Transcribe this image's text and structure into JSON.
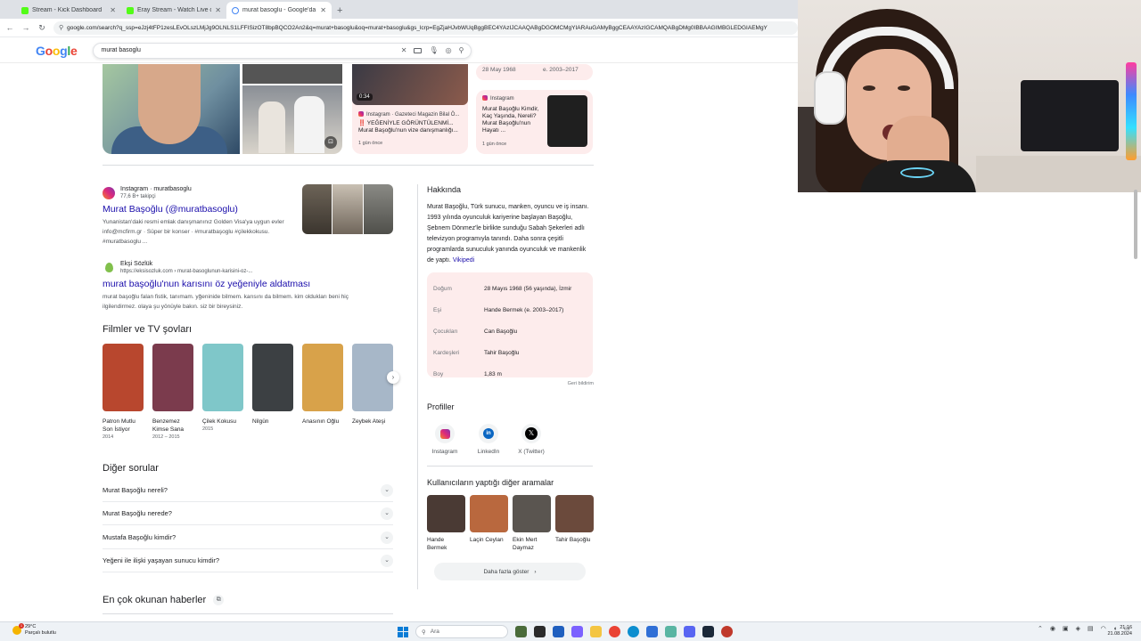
{
  "browser": {
    "tabs": [
      {
        "label": "Stream - Kick Dashboard",
        "favicon": "kick-icon"
      },
      {
        "label": "Eray Stream - Watch Live on Ki",
        "favicon": "kick-icon"
      },
      {
        "label": "murat basoglu - Google'da Ara",
        "favicon": "google-icon",
        "active": true
      }
    ],
    "url": "google.com/search?q_ssp=eJzj4tFP1zesLEvOLszLMjJg9OLNLS1LFFISizOT8bpBQCO2An2&q=murat+basoglu&oq=murat+basoglu&gs_lcrp=EgZjaHJvbWUqBggBEC4YAzIJCAAQABgDGOMCMgYIARAuGAMyBggCEAAYAzIGCAMQABgDMg0IBBAAGIMBGLEDGIAEMgY"
  },
  "search": {
    "logo": "Google",
    "query": "murat basoglu"
  },
  "top_cards": {
    "video_duration": "0:34",
    "card1_source": "Instagram · Gazeteci Magazin Bilal Ö...",
    "card1_title": "‼️ YEĞENİYLE GÖRÜNTÜLENMİ... Murat Başoğlu'nun vize danışmanlığı...",
    "card1_ago": "1 gün önce",
    "card2_date": "28 May 1968",
    "card2_years": "e. 2003–2017",
    "card3_source": "Instagram",
    "card3_title": "Murat Başoğlu Kimdir, Kaç Yaşında, Nereli? Murat Başoğlu'nun Hayatı ...",
    "card3_ago": "1 gün önce"
  },
  "results": [
    {
      "site": "Instagram · muratbasoglu",
      "sub": "77,6 B+ takipçi",
      "title": "Murat Başoğlu (@muratbasoglu)",
      "snippet": "Yunanistan'daki resmi emlak danışmanınız Golden Visa'ya uygun evler info@mcfirm.gr · Süper bir konser · #muratbaşoglu #çilekkokusu. #muratbasoglu ..."
    },
    {
      "site": "Ekşi Sözlük",
      "sub": "https://eksisozluk.com › murat-basoglunun-karisini-oz-...",
      "title": "murat başoğlu'nun karısını öz yeğeniyle aldatması",
      "snippet": "murat başoğlu falan fistik, tanımam. yğeninide bilmem. karısını da bilmem. kim oldukları beni hiç ilgilendirmez. olaya şu yönüyle bakın. siz bir bireysiniz."
    }
  ],
  "films": {
    "heading": "Filmler ve TV şovları",
    "items": [
      {
        "title": "Patron Mutlu Son İstiyor",
        "year": "2014",
        "color": "#b8472e"
      },
      {
        "title": "Benzemez Kimse Sana",
        "year": "2012 – 2015",
        "color": "#7b3b4d"
      },
      {
        "title": "Çilek Kokusu",
        "year": "2015",
        "color": "#7fc7c9"
      },
      {
        "title": "Nilgün",
        "year": "",
        "color": "#3c4043"
      },
      {
        "title": "Anasının Oğlu",
        "year": "",
        "color": "#d8a24a"
      },
      {
        "title": "Zeybek Ateşi",
        "year": "",
        "color": "#a7b7c8"
      }
    ]
  },
  "faq": {
    "heading": "Diğer sorular",
    "items": [
      "Murat Başoğlu nereli?",
      "Murat Başoğlu nerede?",
      "Mustafa Başoğlu kimdir?",
      "Yeğeni ile ilişki yaşayan sunucu kimdir?"
    ]
  },
  "news": {
    "heading": "En çok okunan haberler"
  },
  "knowledge_panel": {
    "about_heading": "Hakkında",
    "about_text": "Murat Başoğlu, Türk sunucu, manken, oyuncu ve iş insanı. 1993 yılında oyunculuk kariyerine başlayan Başoğlu, Şebnem Dönmez'le birlikte sunduğu Sabah Şekerleri adlı televizyon programıyla tanındı. Daha sonra çeşitli programlarda sunuculuk yanında oyunculuk ve mankenlik de yaptı.",
    "wiki": "Vikipedi",
    "facts": [
      {
        "key": "Doğum",
        "value": "28 Mayıs 1968 (56 yaşında), İzmir"
      },
      {
        "key": "Eşi",
        "value": "Hande Bermek (e. 2003–2017)"
      },
      {
        "key": "Çocukları",
        "value": "Can Başoğlu"
      },
      {
        "key": "Kardeşleri",
        "value": "Tahir Başoğlu"
      },
      {
        "key": "Boy",
        "value": "1,83 m"
      }
    ],
    "feedback": "Geri bildirim",
    "profiles_heading": "Profiller",
    "profiles": [
      "Instagram",
      "LinkedIn",
      "X (Twitter)"
    ],
    "people_heading": "Kullanıcıların yaptığı diğer aramalar",
    "people": [
      {
        "name": "Hande Bermek",
        "color": "#4a3a34"
      },
      {
        "name": "Laçin Ceylan",
        "color": "#b9683e"
      },
      {
        "name": "Ekin Mert Daymaz",
        "color": "#5a5550"
      },
      {
        "name": "Tahir Başoğlu",
        "color": "#6b4a3c"
      }
    ],
    "more": "Daha fazla göster"
  },
  "taskbar": {
    "temp": "29°C",
    "weather": "Parçalı bulutlu",
    "search": "Ara",
    "time": "21:16",
    "date": "21.08.2024"
  }
}
